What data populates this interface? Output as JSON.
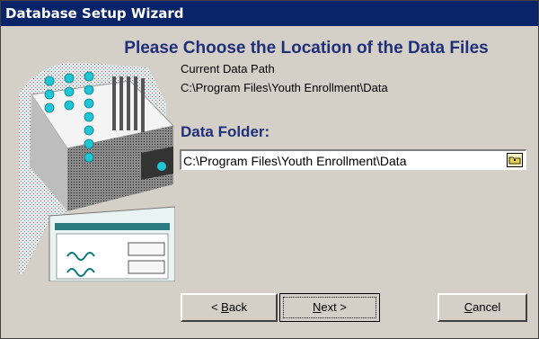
{
  "window": {
    "title": "Database Setup Wizard"
  },
  "heading": "Please Choose the Location of the Data Files",
  "current_path": {
    "label": "Current Data Path",
    "value": "C:\\Program Files\\Youth Enrollment\\Data"
  },
  "data_folder": {
    "label": "Data Folder:",
    "value": "C:\\Program Files\\Youth Enrollment\\Data"
  },
  "buttons": {
    "back_prefix": "< ",
    "back_mnemonic": "B",
    "back_rest": "ack",
    "next_mnemonic": "N",
    "next_rest": "ext >",
    "cancel_mnemonic": "C",
    "cancel_rest": "ancel"
  },
  "icons": {
    "browse": "folder-icon",
    "art": "computer-illustration"
  }
}
